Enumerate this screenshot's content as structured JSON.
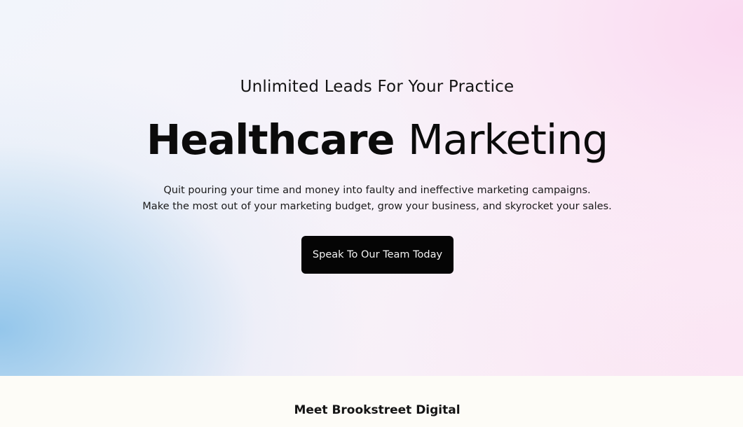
{
  "hero": {
    "eyebrow": "Unlimited Leads For Your Practice",
    "headline_bold": "Healthcare",
    "headline_light": "Marketing",
    "body_line_1": "Quit pouring your time and money into faulty and ineffective marketing campaigns.",
    "body_line_2": "Make the most out of your marketing budget, grow your business, and skyrocket your sales.",
    "cta_label": "Speak To Our Team Today"
  },
  "next_section": {
    "title": "Meet Brookstreet Digital"
  },
  "colors": {
    "cta_background": "#050505",
    "page_background": "#fdfcf7",
    "gradient_blue": "#8fc4ea",
    "gradient_pink": "#fad7f0"
  }
}
